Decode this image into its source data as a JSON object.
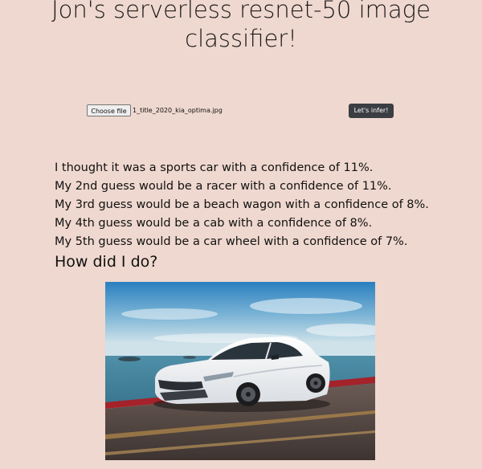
{
  "page": {
    "title": "Jon's serverless resnet-50 image classifier!"
  },
  "upload": {
    "choose_label": "Choose file",
    "file_name": "1_title_2020_kia_optima.jpg",
    "submit_label": "Let's infer!"
  },
  "results": [
    "I thought it was a sports car with a confidence of 11%.",
    "My 2nd guess would be a racer with a confidence of 11%.",
    "My 3rd guess would be a beach wagon with a confidence of 8%.",
    "My 4th guess would be a cab with a confidence of 8%.",
    "My 5th guess would be a car wheel with a confidence of 7%."
  ],
  "question": "How did I do?",
  "colors": {
    "background": "#efd8cf",
    "button_dark": "#3b3e42"
  },
  "image": {
    "subject": "white sedan photo"
  }
}
